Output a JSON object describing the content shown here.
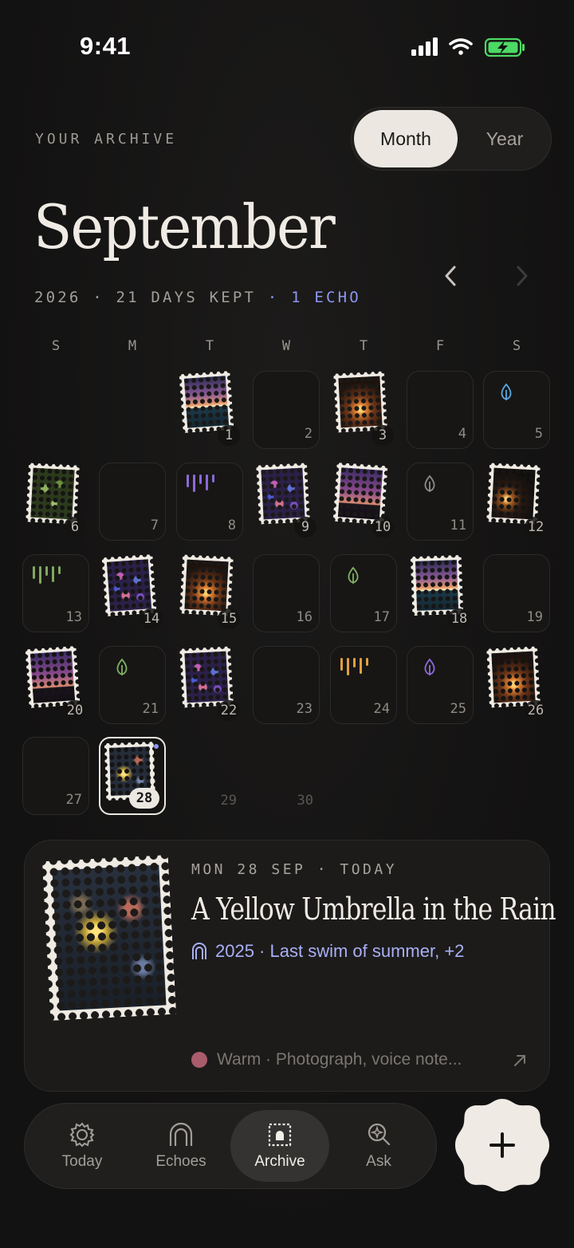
{
  "status_bar": {
    "time": "9:41"
  },
  "header": {
    "eyebrow": "YOUR ARCHIVE",
    "view_toggle": {
      "month": "Month",
      "year": "Year",
      "selected": "Month"
    },
    "month_title": "September",
    "year": "2026",
    "sep1": " · ",
    "days_kept": "21 DAYS KEPT",
    "sep2": " · ",
    "echo": "1 ECHO"
  },
  "weekdays": [
    "S",
    "M",
    "T",
    "W",
    "T",
    "F",
    "S"
  ],
  "days": [
    {
      "n": "1",
      "kind": "stamp",
      "photo": "sunset"
    },
    {
      "n": "2",
      "kind": "empty"
    },
    {
      "n": "3",
      "kind": "stamp",
      "photo": "glow"
    },
    {
      "n": "4",
      "kind": "empty"
    },
    {
      "n": "5",
      "kind": "drop",
      "color": "#5aa8e0"
    },
    {
      "n": "6",
      "kind": "stamp",
      "photo": "green"
    },
    {
      "n": "7",
      "kind": "empty"
    },
    {
      "n": "8",
      "kind": "voice",
      "color": "#8c6ad8"
    },
    {
      "n": "9",
      "kind": "stamp",
      "photo": "bokeh"
    },
    {
      "n": "10",
      "kind": "stamp",
      "photo": "city"
    },
    {
      "n": "11",
      "kind": "drop",
      "color": "#8f8b85"
    },
    {
      "n": "12",
      "kind": "stamp",
      "photo": "window"
    },
    {
      "n": "13",
      "kind": "voice",
      "color": "#7fa860"
    },
    {
      "n": "14",
      "kind": "stamp",
      "photo": "bokeh"
    },
    {
      "n": "15",
      "kind": "stamp",
      "photo": "glow"
    },
    {
      "n": "16",
      "kind": "empty"
    },
    {
      "n": "17",
      "kind": "drop",
      "color": "#7fb060"
    },
    {
      "n": "18",
      "kind": "stamp",
      "photo": "sunset"
    },
    {
      "n": "19",
      "kind": "empty"
    },
    {
      "n": "20",
      "kind": "stamp",
      "photo": "city"
    },
    {
      "n": "21",
      "kind": "drop",
      "color": "#7fb060"
    },
    {
      "n": "22",
      "kind": "stamp",
      "photo": "bokeh"
    },
    {
      "n": "23",
      "kind": "empty"
    },
    {
      "n": "24",
      "kind": "voice",
      "color": "#e0a040"
    },
    {
      "n": "25",
      "kind": "drop",
      "color": "#8c6ad8"
    },
    {
      "n": "26",
      "kind": "stamp",
      "photo": "glow"
    },
    {
      "n": "27",
      "kind": "empty"
    },
    {
      "n": "28",
      "kind": "today",
      "photo": "night"
    },
    {
      "n": "29",
      "kind": "future"
    },
    {
      "n": "30",
      "kind": "future"
    }
  ],
  "first_weekday": 2,
  "featured": {
    "kicker": "MON 28 SEP · TODAY",
    "title": "A Yellow Umbrella in the Rain",
    "echo_text": "2025 · Last swim of summer, +2",
    "footer": "Warm · Photograph, voice note..."
  },
  "tabs": [
    {
      "label": "Today",
      "icon": "sun-icon"
    },
    {
      "label": "Echoes",
      "icon": "arch-icon"
    },
    {
      "label": "Archive",
      "icon": "archive-icon",
      "active": true
    },
    {
      "label": "Ask",
      "icon": "sparkle-search-icon"
    }
  ],
  "colors": {
    "accent": "#8c96f0",
    "stamp_paper": "#efebe3",
    "background": "#141313"
  }
}
